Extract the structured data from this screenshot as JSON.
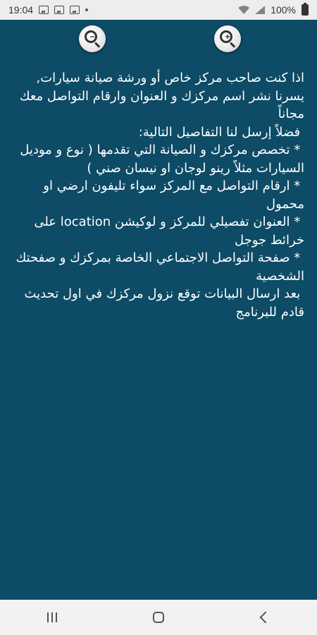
{
  "status_bar": {
    "time": "19:04",
    "battery": "100%",
    "left_icons": [
      "image-icon",
      "image-icon",
      "mail-icon",
      "dot-icon"
    ],
    "right_icons": [
      "wifi-icon",
      "signal-icon",
      "battery-icon"
    ]
  },
  "toolbar": {
    "zoom_out_icon": "zoom-out-icon",
    "zoom_in_icon": "zoom-in-icon"
  },
  "content": {
    "text": "اذا كنت صاحب مركز خاص أو ورشة صيانة سيارات, يسرنا نشر اسم مركزك و العنوان وارقام التواصل معك مجاناً\n فضلاً إرسل لنا التفاصيل التالية:\n * تخصص مركزك و الصيانة التي تقدمها ( نوع و موديل السيارات مثلاً رينو لوجان او نيسان صني )\n * ارقام التواصل مع المركز سواء تليفون ارضي او محمول\n * العنوان تفصيلي للمركز و لوكيشن location على خرائط جوجل\n * صفحة التواصل الاجتماعي الخاصة بمركزك و صفحتك الشخصية\n بعد ارسال البيانات توقع نزول مركزك في اول تحديث قادم للبرنامج"
  },
  "nav_bar": {
    "items": [
      "recents-icon",
      "home-icon",
      "back-icon"
    ]
  },
  "colors": {
    "background": "#0d4b66",
    "status_bar": "#ededed",
    "nav_bar": "#f2f2f2",
    "text": "#ffffff"
  }
}
